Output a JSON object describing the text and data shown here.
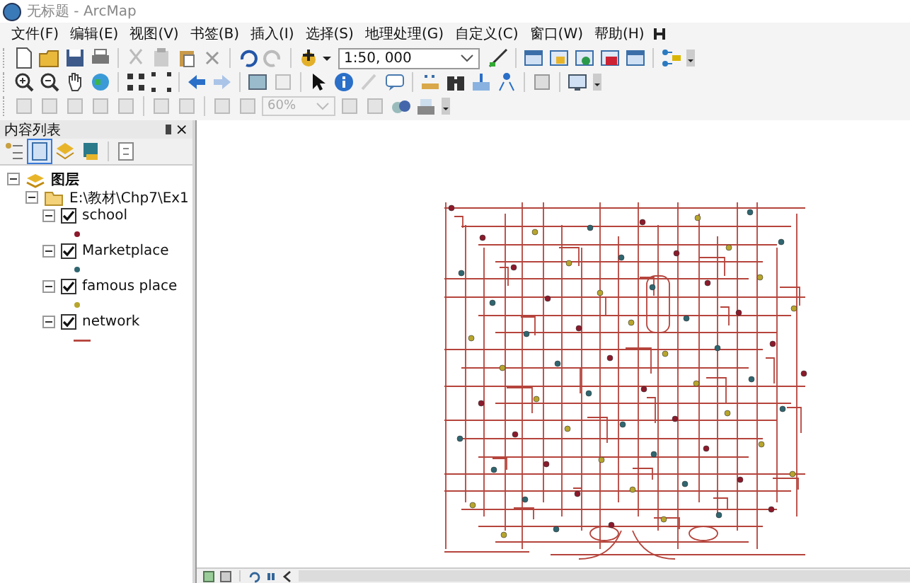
{
  "window": {
    "title": "无标题 - ArcMap"
  },
  "menu": [
    {
      "label": "文件(F)"
    },
    {
      "label": "编辑(E)"
    },
    {
      "label": "视图(V)"
    },
    {
      "label": "书签(B)"
    },
    {
      "label": "插入(I)"
    },
    {
      "label": "选择(S)"
    },
    {
      "label": "地理处理(G)"
    },
    {
      "label": "自定义(C)"
    },
    {
      "label": "窗口(W)"
    },
    {
      "label": "帮助(H)"
    }
  ],
  "toolbar": {
    "scale": "1:50, 000",
    "zoom_percent": "60%"
  },
  "toc": {
    "title": "内容列表",
    "close": "×",
    "root": {
      "label": "图层",
      "expanded": true,
      "children": [
        {
          "label": "E:\\教材\\Chp7\\Ex1",
          "expanded": true,
          "children": [
            {
              "label": "school",
              "kind": "point",
              "checked": true,
              "expanded": true,
              "color": "#8b1a2b"
            },
            {
              "label": "Marketplace",
              "kind": "point",
              "checked": true,
              "expanded": true,
              "color": "#2f6670"
            },
            {
              "label": "famous place",
              "kind": "point",
              "checked": true,
              "expanded": true,
              "color": "#b7a52c"
            },
            {
              "label": "network",
              "kind": "line",
              "checked": true,
              "expanded": true,
              "color": "#b5443c"
            }
          ]
        }
      ]
    }
  }
}
